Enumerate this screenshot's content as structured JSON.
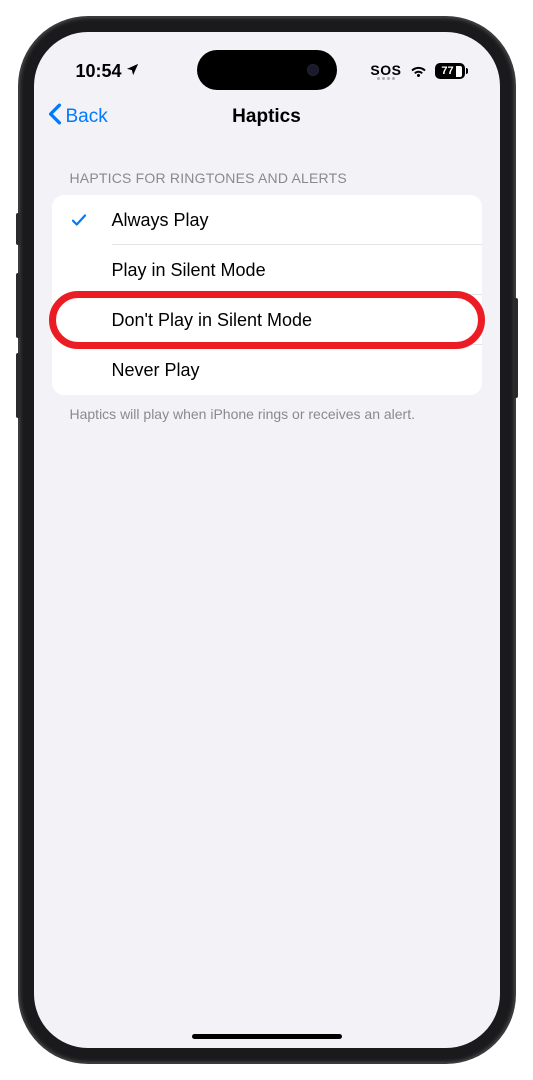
{
  "status_bar": {
    "time": "10:54",
    "sos": "SOS",
    "battery": "77"
  },
  "nav": {
    "back_label": "Back",
    "title": "Haptics"
  },
  "section": {
    "header": "HAPTICS FOR RINGTONES AND ALERTS",
    "footer": "Haptics will play when iPhone rings or receives an alert."
  },
  "options": [
    {
      "label": "Always Play",
      "selected": true,
      "highlighted": false
    },
    {
      "label": "Play in Silent Mode",
      "selected": false,
      "highlighted": false
    },
    {
      "label": "Don't Play in Silent Mode",
      "selected": false,
      "highlighted": true
    },
    {
      "label": "Never Play",
      "selected": false,
      "highlighted": false
    }
  ]
}
